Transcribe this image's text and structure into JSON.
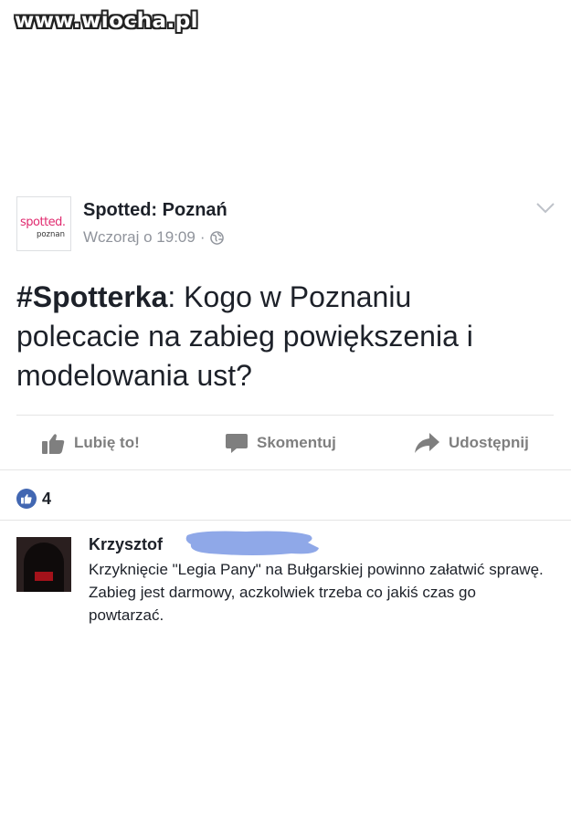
{
  "watermark": "www.wiocha.pl",
  "post": {
    "page_name": "Spotted: Poznań",
    "avatar": {
      "logo_text": "spotted.",
      "logo_subtext": "poznan"
    },
    "timestamp": "Wczoraj o 19:09",
    "separator": "·",
    "privacy_icon": "globe-icon",
    "menu_icon": "chevron-down-icon",
    "hashtag": "#Spotterka",
    "body": ": Kogo w Poznaniu polecacie na zabieg powiększenia i modelowania ust?"
  },
  "actions": {
    "like_label": "Lubię to!",
    "comment_label": "Skomentuj",
    "share_label": "Udostępnij"
  },
  "reactions": {
    "icon": "thumbs-up-icon",
    "count": "4"
  },
  "comment": {
    "author": "Krzysztof",
    "text": "Krzyknięcie \"Legia Pany\" na Bułgarskiej powinno załatwić sprawę. Zabieg jest darmowy, aczkolwiek trzeba co jakiś czas go powtarzać."
  },
  "colors": {
    "accent": "#4267b2",
    "text": "#1d2129",
    "muted": "#90949c",
    "redaction": "#8fa8e8",
    "logo_pink": "#e02b6f"
  }
}
